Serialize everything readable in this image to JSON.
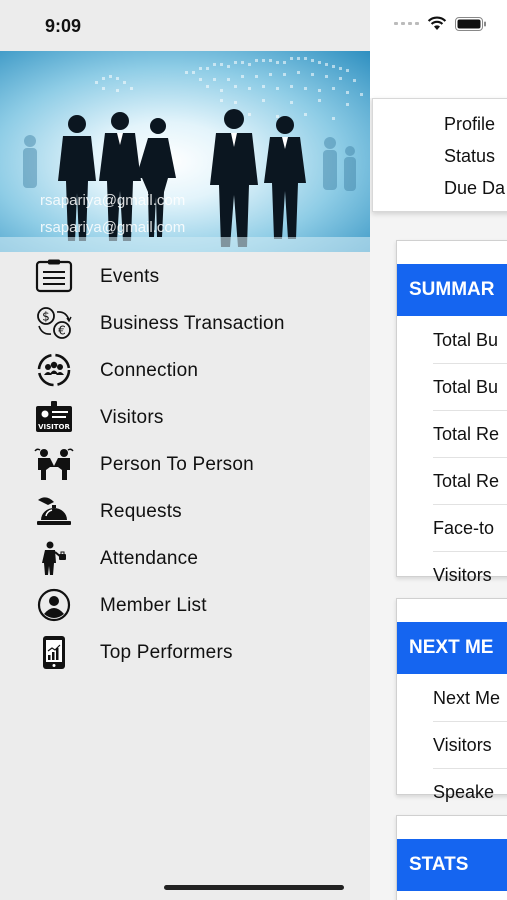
{
  "status_bar": {
    "time": "9:09"
  },
  "drawer": {
    "emails": [
      "rsapariya@gmail.com",
      "rsapariya@gmail.com"
    ],
    "menu_items": [
      {
        "label": "Events",
        "icon": "clipboard-list-icon"
      },
      {
        "label": "Business Transaction",
        "icon": "currency-exchange-icon"
      },
      {
        "label": "Connection",
        "icon": "connection-icon"
      },
      {
        "label": "Visitors",
        "icon": "visitor-badge-icon"
      },
      {
        "label": "Person To Person",
        "icon": "handshake-icon"
      },
      {
        "label": "Requests",
        "icon": "service-bell-icon"
      },
      {
        "label": "Attendance",
        "icon": "attendance-person-icon"
      },
      {
        "label": "Member List",
        "icon": "member-avatar-icon"
      },
      {
        "label": "Top Performers",
        "icon": "phone-chart-icon"
      }
    ]
  },
  "main": {
    "profile_card": [
      "Profile",
      "Status",
      "Due Da"
    ],
    "summary": {
      "header": "SUMMAR",
      "rows": [
        "Total Bu",
        "Total Bu",
        "Total Re",
        "Total Re",
        "Face-to",
        "Visitors"
      ]
    },
    "next_meeting": {
      "header": "NEXT ME",
      "rows": [
        "Next Me",
        "Visitors",
        "Speake"
      ]
    },
    "stats": {
      "header": "STATS"
    }
  },
  "colors": {
    "accent": "#1565f0",
    "drawer_bg": "#ececec",
    "content_bg": "#f4f4f4"
  }
}
